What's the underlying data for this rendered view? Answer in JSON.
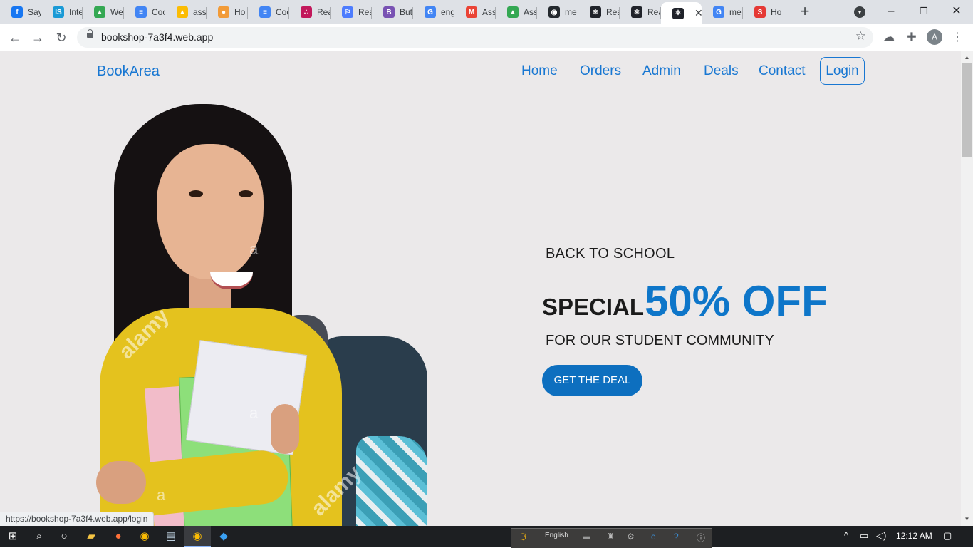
{
  "browser": {
    "tabs": [
      {
        "label": "Say",
        "icon": "facebook-icon",
        "color": "#1877f2",
        "glyph": "f"
      },
      {
        "label": "Inte",
        "icon": "is-icon",
        "color": "#1a9ad6",
        "glyph": "IS"
      },
      {
        "label": "We",
        "icon": "google-drive-icon",
        "color": "#34a853",
        "glyph": "▲"
      },
      {
        "label": "Coc",
        "icon": "google-docs-icon",
        "color": "#4285f4",
        "glyph": "≡"
      },
      {
        "label": "ass",
        "icon": "google-drive-icon",
        "color": "#fbbc04",
        "glyph": "▲"
      },
      {
        "label": "Ho",
        "icon": "pill-icon",
        "color": "#f29b38",
        "glyph": "●"
      },
      {
        "label": "Coc",
        "icon": "google-docs-icon",
        "color": "#4285f4",
        "glyph": "≡"
      },
      {
        "label": "Rea",
        "icon": "dots-icon",
        "color": "#c2185b",
        "glyph": "∴"
      },
      {
        "label": "Rea",
        "icon": "flag-icon",
        "color": "#4d7cfe",
        "glyph": "⚐"
      },
      {
        "label": "But",
        "icon": "bootstrap-icon",
        "color": "#7952b3",
        "glyph": "B"
      },
      {
        "label": "eng",
        "icon": "google-icon",
        "color": "#4285f4",
        "glyph": "G"
      },
      {
        "label": "Ass",
        "icon": "gmail-icon",
        "color": "#ea4335",
        "glyph": "M"
      },
      {
        "label": "Ass",
        "icon": "google-drive-icon",
        "color": "#34a853",
        "glyph": "▲"
      },
      {
        "label": "me",
        "icon": "github-icon",
        "color": "#24292e",
        "glyph": "◉"
      },
      {
        "label": "Rea",
        "icon": "react-icon",
        "color": "#20232a",
        "glyph": "⚛"
      },
      {
        "label": "Rea",
        "icon": "react-icon",
        "color": "#20232a",
        "glyph": "⚛"
      },
      {
        "label": "",
        "icon": "react-icon",
        "color": "#20232a",
        "glyph": "⚛",
        "active": true
      },
      {
        "label": "me",
        "icon": "google-icon",
        "color": "#4285f4",
        "glyph": "G"
      },
      {
        "label": "Ho",
        "icon": "s-icon",
        "color": "#e53935",
        "glyph": "S"
      }
    ],
    "url": "bookshop-7a3f4.web.app",
    "profile_initial": "A",
    "status_url": "https://bookshop-7a3f4.web.app/login"
  },
  "site": {
    "brand": "BookArea",
    "nav": {
      "home": "Home",
      "orders": "Orders",
      "admin": "Admin",
      "deals": "Deals",
      "contact": "Contact",
      "login": "Login"
    },
    "hero": {
      "eyebrow": "BACK TO SCHOOL",
      "special": "SPECIAL",
      "discount": "50% OFF",
      "subtitle": "FOR OUR STUDENT COMMUNITY",
      "cta": "GET THE DEAL",
      "watermark": "alamy",
      "watermark_mark": "a"
    },
    "accent": "#1877d2"
  },
  "taskbar": {
    "language": "English",
    "time": "12:12 AM"
  }
}
